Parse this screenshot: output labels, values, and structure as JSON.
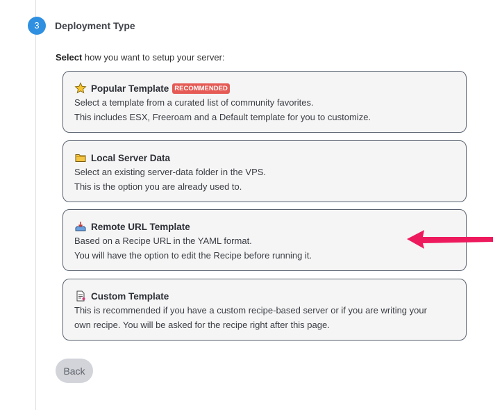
{
  "step": {
    "number": "3",
    "title": "Deployment Type"
  },
  "intro": {
    "bold": "Select",
    "rest": " how you want to setup your server:"
  },
  "options": [
    {
      "icon": "star-icon",
      "title": "Popular Template",
      "badge": "RECOMMENDED",
      "line1": "Select a template from a curated list of community favorites.",
      "line2": "This includes ESX, Freeroam and a Default template for you to customize."
    },
    {
      "icon": "folder-icon",
      "title": "Local Server Data",
      "line1": "Select an existing server-data folder in the VPS.",
      "line2": "This is the option you are already used to."
    },
    {
      "icon": "download-tray-icon",
      "title": "Remote URL Template",
      "line1": "Based on a Recipe URL in the YAML format.",
      "line2": "You will have the option to edit the Recipe before running it."
    },
    {
      "icon": "document-icon",
      "title": "Custom Template",
      "line1": "This is recommended if you have a custom recipe-based server or if you are writing your",
      "line2": "own recipe. You will be asked for the recipe right after this page."
    }
  ],
  "back_label": "Back",
  "colors": {
    "accent": "#2f8fe0",
    "badge": "#e55a54",
    "arrow": "#ee1a5e"
  }
}
